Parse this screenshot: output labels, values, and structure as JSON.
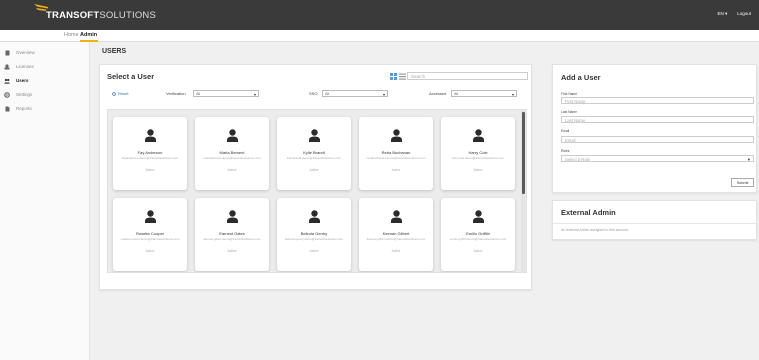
{
  "header": {
    "brand_bold": "TRANSOFT",
    "brand_thin": "SOLUTIONS",
    "language": "EN ▾",
    "logout": "Logout",
    "accent": "#f2b10d"
  },
  "subnav": {
    "tabs": [
      {
        "label": "Home",
        "active": false
      },
      {
        "label": "Admin",
        "active": true
      }
    ]
  },
  "sidebar": {
    "items": [
      {
        "label": "Overview",
        "icon": "document-icon",
        "active": false
      },
      {
        "label": "Licenses",
        "icon": "license-icon",
        "active": false
      },
      {
        "label": "Users",
        "icon": "users-icon",
        "active": true
      },
      {
        "label": "Settings",
        "icon": "settings-icon",
        "active": false
      },
      {
        "label": "Reports",
        "icon": "report-icon",
        "active": false
      }
    ]
  },
  "main": {
    "page_title": "USERS",
    "select_user": {
      "title": "Select a User",
      "search_placeholder": "Search",
      "reset_label": "Reset",
      "filters": [
        {
          "label": "Verification",
          "value": "All"
        },
        {
          "label": "SSO",
          "value": "All"
        },
        {
          "label": "Accessed",
          "value": "All"
        }
      ],
      "users": [
        {
          "name": "Fay Anderson",
          "email": "fayanderson.demo@transoftsolutions.com",
          "status": "Active"
        },
        {
          "name": "Maria Bement",
          "email": "mariabement.demo@transoftsolutions.com",
          "status": "Active"
        },
        {
          "name": "Kylie Brandt",
          "email": "kyliebrandt.demo@transoftsolutions.com",
          "status": "Active"
        },
        {
          "name": "Reba Buchanan",
          "email": "rebabuchanan.demo@transoftsolutions.com",
          "status": "Active"
        },
        {
          "name": "Harry Cole",
          "email": "harrycole.demo@transoftsolutions.com",
          "status": "Active"
        },
        {
          "name": "Rosetta Cooper",
          "email": "rosetta.cooper.demo@transoftsolutions.com",
          "status": "Active"
        },
        {
          "name": "Earnest Gates",
          "email": "earnest.gates.demo@transoftsolutions.com",
          "status": "Active"
        },
        {
          "name": "Belinda Gentry",
          "email": "belinda.gentry.demo@transoftsolutions.com",
          "status": "Active"
        },
        {
          "name": "Keenan Gilbert",
          "email": "keenan.gilbert.demo@transoftsolutions.com",
          "status": "Active"
        },
        {
          "name": "Emilio Griffith",
          "email": "emilio.griffith.demo@transoftsolutions.com",
          "status": "Active"
        }
      ]
    }
  },
  "add_user": {
    "title": "Add a User",
    "first_name_label": "First Name",
    "first_name_placeholder": "First Name",
    "last_name_label": "Last Name",
    "last_name_placeholder": "Last Name",
    "email_label": "Email",
    "email_placeholder": "Email",
    "roles_label": "Roles",
    "roles_placeholder": "Select a Role",
    "submit_label": "Submit"
  },
  "external_admin": {
    "title": "External Admin",
    "message": "An external Admin assigned to this account."
  }
}
